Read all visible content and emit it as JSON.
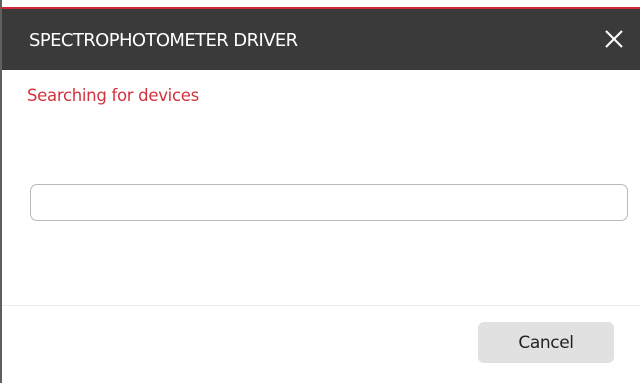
{
  "dialog": {
    "title": "SPECTROPHOTOMETER DRIVER",
    "close_icon": "close-icon",
    "status_text": "Searching for devices",
    "progress": 0,
    "cancel_label": "Cancel"
  },
  "colors": {
    "accent": "#d6253a",
    "titlebar_bg": "#3a3a3a",
    "status_text": "#d2323d",
    "button_bg": "#e1e1e1"
  }
}
